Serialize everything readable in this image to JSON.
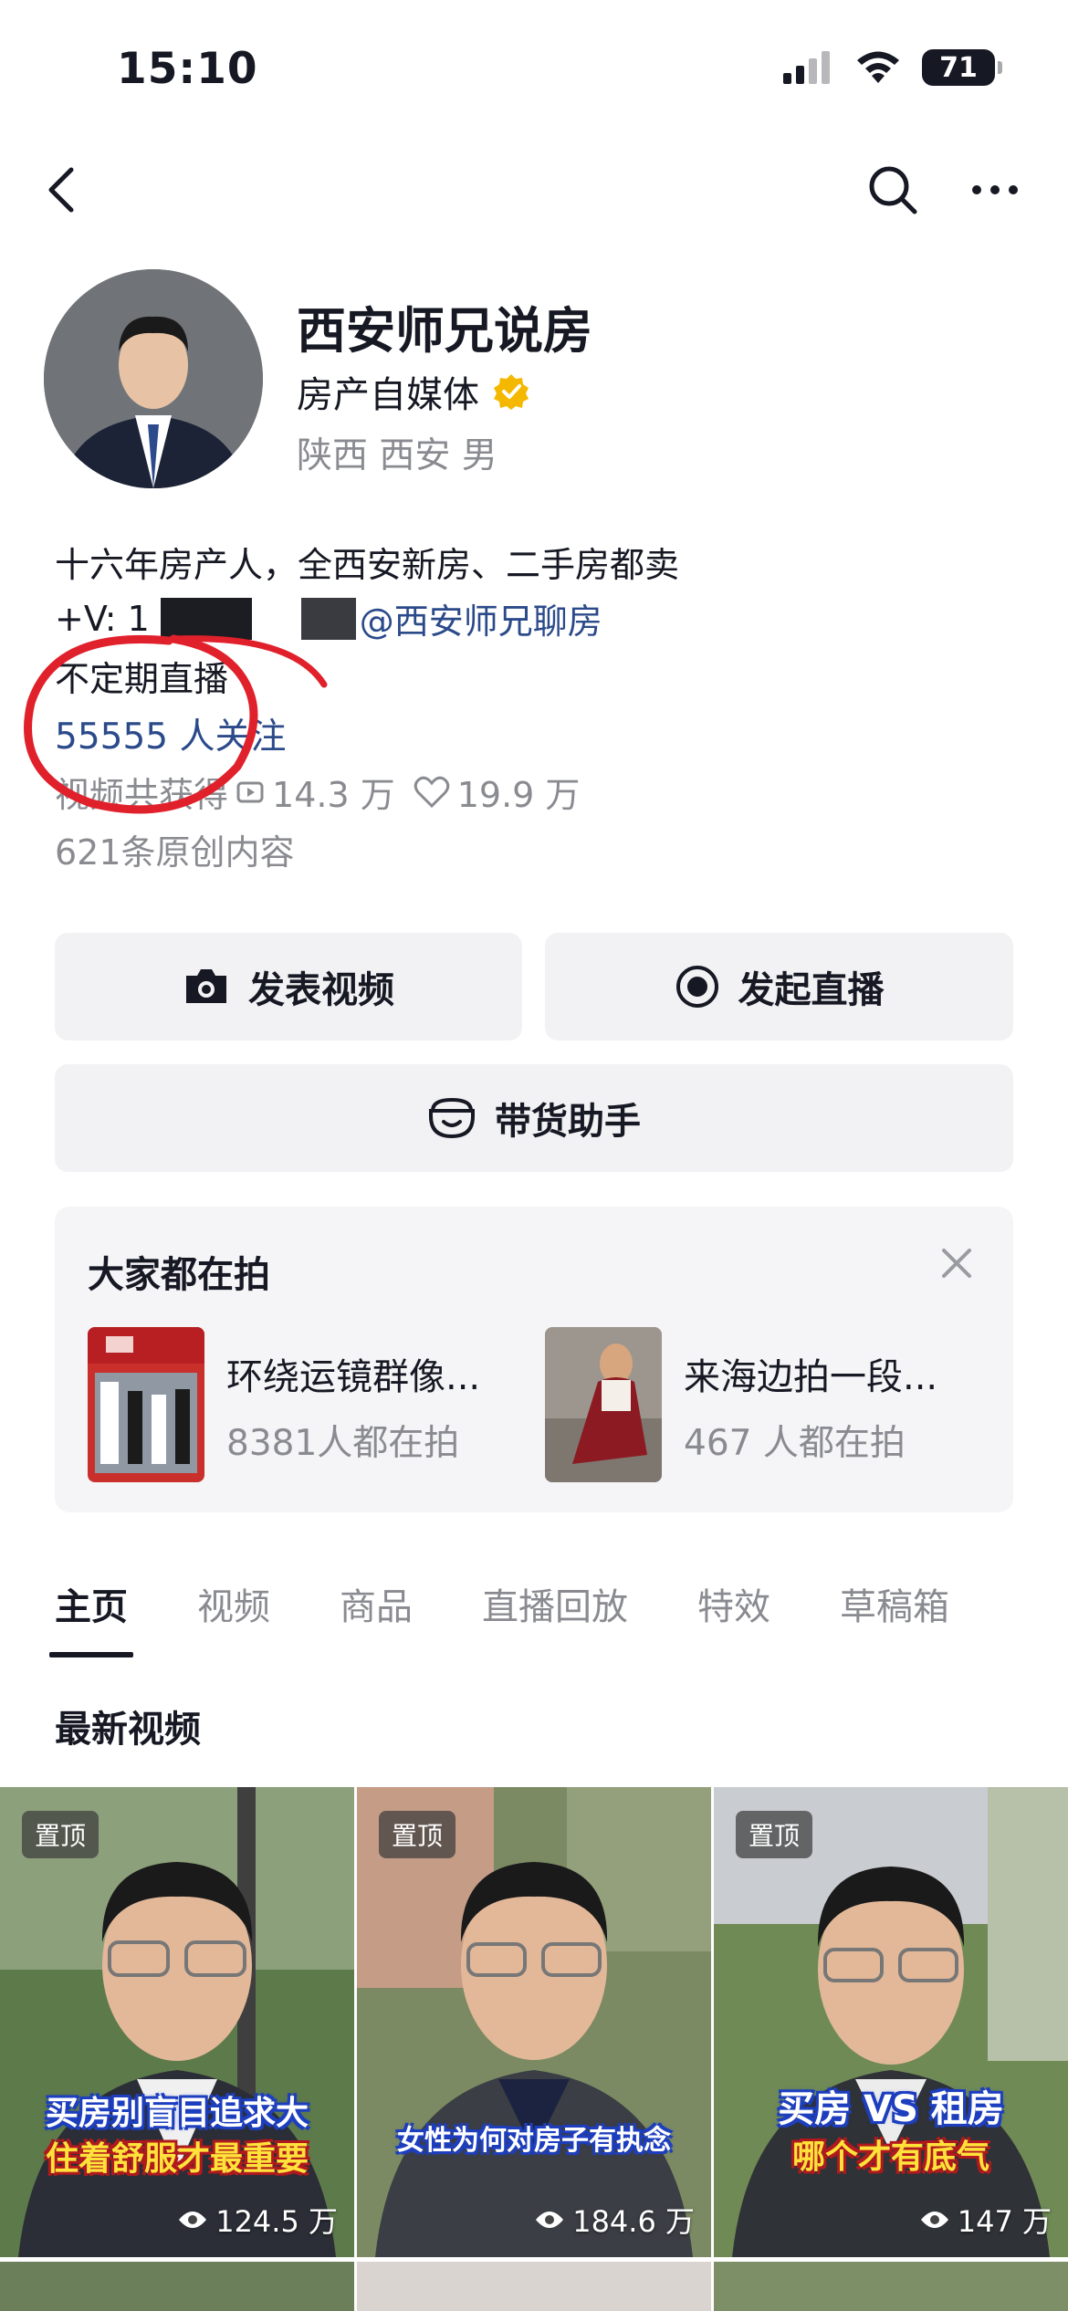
{
  "status_bar": {
    "time": "15:10",
    "battery": "71"
  },
  "profile": {
    "name": "西安师兄说房",
    "profession": "房产自媒体",
    "location": "陕西 西安 男",
    "bio_line1": "十六年房产人，全西安新房、二手房都卖",
    "bio_line2_prefix": "+V: 1",
    "bio_line2_mention": "@西安师兄聊房",
    "bio_line3": "不定期直播",
    "followers": "55555 人关注",
    "stats_prefix": "视频共获得",
    "plays": "14.3 万",
    "likes": "19.9 万",
    "originals": "621条原创内容"
  },
  "actions": {
    "post_video": "发表视频",
    "start_live": "发起直播",
    "sales_assistant": "带货助手"
  },
  "trending": {
    "title": "大家都在拍",
    "items": [
      {
        "name": "环绕运镜群像...",
        "count": "8381人都在拍"
      },
      {
        "name": "来海边拍一段...",
        "count": "467 人都在拍"
      }
    ]
  },
  "tabs": [
    "主页",
    "视频",
    "商品",
    "直播回放",
    "特效",
    "草稿箱"
  ],
  "section_title": "最新视频",
  "videos": [
    {
      "pin": "置顶",
      "caption1": "买房别盲目追求大",
      "caption2": "住着舒服才最重要",
      "views": "124.5 万"
    },
    {
      "pin": "置顶",
      "caption1": "女性为何对房子有执念",
      "caption2": "",
      "views": "184.6 万"
    },
    {
      "pin": "置顶",
      "caption1": "买房 VS 租房",
      "caption2": "哪个才有底气",
      "views": "147 万"
    }
  ],
  "colors": {
    "accent_text": "#2b4a8a",
    "muted": "#8a8b91",
    "annotation_red": "#e0202b",
    "verified": "#f5b800"
  }
}
